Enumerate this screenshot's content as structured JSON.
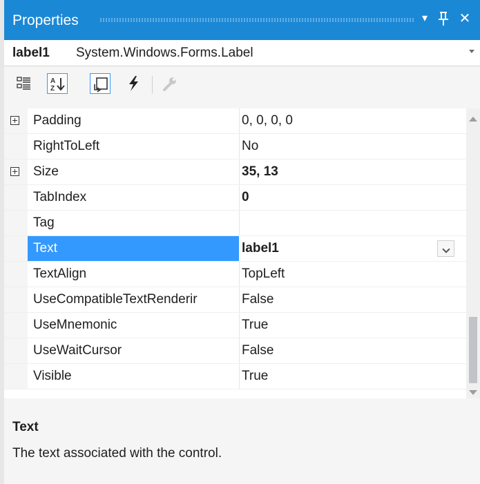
{
  "window": {
    "title": "Properties",
    "dropdown_glyph": "▾",
    "pin_glyph": "ꟼ",
    "close_glyph": "✕"
  },
  "object_selector": {
    "name": "label1",
    "type": "System.Windows.Forms.Label"
  },
  "toolbar": {
    "items": [
      {
        "icon": "categorized-icon",
        "active": false
      },
      {
        "icon": "alphabetical-icon",
        "active": true
      },
      {
        "icon": "properties-icon",
        "active": true
      },
      {
        "icon": "events-icon",
        "active": false
      },
      {
        "icon": "property-pages-icon",
        "active": false
      }
    ]
  },
  "properties": [
    {
      "name": "Padding",
      "value": "0, 0, 0, 0",
      "expandable": true,
      "bold": false
    },
    {
      "name": "RightToLeft",
      "value": "No",
      "expandable": false,
      "bold": false
    },
    {
      "name": "Size",
      "value": "35, 13",
      "expandable": true,
      "bold": true
    },
    {
      "name": "TabIndex",
      "value": "0",
      "expandable": false,
      "bold": true
    },
    {
      "name": "Tag",
      "value": "",
      "expandable": false,
      "bold": false
    },
    {
      "name": "Text",
      "value": "label1",
      "expandable": false,
      "bold": true,
      "selected": true
    },
    {
      "name": "TextAlign",
      "value": "TopLeft",
      "expandable": false,
      "bold": false
    },
    {
      "name": "UseCompatibleTextRenderir",
      "value": "False",
      "expandable": false,
      "bold": false
    },
    {
      "name": "UseMnemonic",
      "value": "True",
      "expandable": false,
      "bold": false
    },
    {
      "name": "UseWaitCursor",
      "value": "False",
      "expandable": false,
      "bold": false
    },
    {
      "name": "Visible",
      "value": "True",
      "expandable": false,
      "bold": false
    }
  ],
  "description": {
    "title": "Text",
    "text": "The text associated with the control."
  },
  "colors": {
    "title_bar": "#1b88d6",
    "selection": "#3399ff",
    "panel": "#f5f5f5"
  }
}
